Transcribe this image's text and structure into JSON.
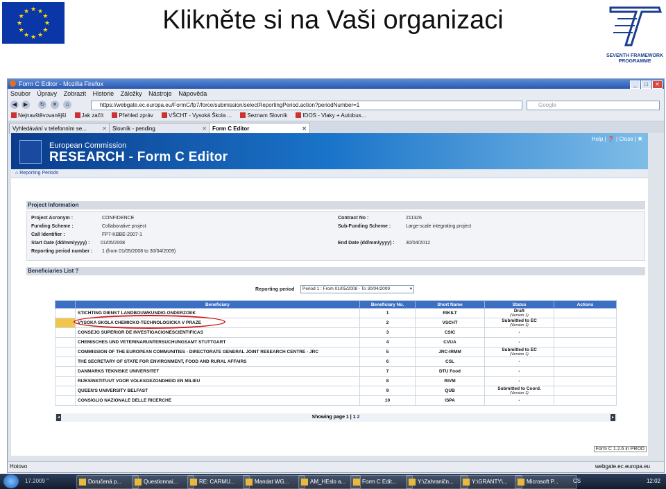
{
  "slide": {
    "title": "Klikněte si na Vaši organizaci",
    "logo_left": "eu-flag",
    "logo_right": {
      "line1": "SEVENTH FRAMEWORK",
      "line2": "PROGRAMME"
    }
  },
  "browser": {
    "window_title": "Form C Editor - Mozilla Firefox",
    "menu": [
      "Soubor",
      "Úpravy",
      "Zobrazit",
      "Historie",
      "Záložky",
      "Nástroje",
      "Nápověda"
    ],
    "url": "https://webgate.ec.europa.eu/FormC/fp7/force/submission/selectReportingPeriod.action?periodNumber=1",
    "search_placeholder": "Google",
    "bookmarks": [
      "Nejnavštěvovanější",
      "Jak začít",
      "Přehled zpráv",
      "VŠCHT - Vysoká Škola ...",
      "Seznam Slovník",
      "IDOS - Vlaky + Autobus..."
    ],
    "tabs": [
      {
        "label": "Vyhledávání v telefonním se...",
        "active": false
      },
      {
        "label": "Slovník - pending",
        "active": false
      },
      {
        "label": "Form C Editor",
        "active": true
      }
    ],
    "status_left": "Hotovo",
    "status_right": "webgate.ec.europa.eu"
  },
  "app": {
    "line1": "European Commission",
    "line2": "RESEARCH - Form C Editor",
    "help_links": "Help | ❓ | Close | ✖",
    "breadcrumb": "Reporting Periods",
    "project_section": "Project Information",
    "project": {
      "acronym_label": "Project Acronym :",
      "acronym": "CONFIDENCE",
      "funding_label": "Funding Scheme :",
      "funding": "Collaborative project",
      "call_label": "Call Identifier :",
      "call": "FP7-KBBE-2007-1",
      "start_label": "Start Date (dd/mm/yyyy) :",
      "start": "01/05/2008",
      "period_label": "Reporting period number :",
      "period": "1 (from 01/05/2008 to 30/04/2009)",
      "contract_label": "Contract No :",
      "contract": "211326",
      "subfunding_label": "Sub-Funding Scheme :",
      "subfunding": "Large-scale integrating project",
      "end_label": "End Date (dd/mm/yyyy) :",
      "end": "30/04/2012"
    },
    "beneficiaries_section": "Beneficiaries List ?",
    "reporting_period_label": "Reporting period",
    "reporting_period_value": "Period 1 : From 01/05/2008 - To 30/04/2009",
    "columns": [
      "Beneficiary",
      "Beneficiary No.",
      "Short Name",
      "Status",
      "Actions"
    ],
    "rows": [
      {
        "name": "STICHTING DIENST LANDBOUWKUNDIG ONDERZOEK",
        "no": "1",
        "short": "RIKILT",
        "status": "Draft",
        "version": "(Version 1)"
      },
      {
        "name": "VYSOKA SKOLA CHEMICKO-TECHNOLOGICKA V PRAZE",
        "no": "2",
        "short": "VSCHT",
        "status": "Submitted to EC",
        "version": "(Version 1)"
      },
      {
        "name": "CONSEJO SUPERIOR DE INVESTIGACIONESCIENTIFICAS",
        "no": "3",
        "short": "CSIC",
        "status": "-",
        "version": ""
      },
      {
        "name": "CHEMISCHES UND VETERINARUNTERSUCHUNGSAMT STUTTGART",
        "no": "4",
        "short": "CVUA",
        "status": "-",
        "version": ""
      },
      {
        "name": "COMMISSION OF THE EUROPEAN COMMUNITIES - DIRECTORATE GENERAL JOINT RESEARCH CENTRE - JRC",
        "no": "5",
        "short": "JRC-IRMM",
        "status": "Submitted to EC",
        "version": "(Version 1)"
      },
      {
        "name": "THE SECRETARY OF STATE FOR ENVIRONMENT, FOOD AND RURAL AFFAIRS",
        "no": "6",
        "short": "CSL",
        "status": "-",
        "version": ""
      },
      {
        "name": "DANMARKS TEKNISKE UNIVERSITET",
        "no": "7",
        "short": "DTU Food",
        "status": "-",
        "version": ""
      },
      {
        "name": "RIJKSINSTITUUT VOOR VOLKSGEZONDHEID EN MILIEU",
        "no": "8",
        "short": "RIVM",
        "status": "-",
        "version": ""
      },
      {
        "name": "QUEEN'S UNIVERSITY BELFAST",
        "no": "9",
        "short": "QUB",
        "status": "Submitted to Coord.",
        "version": "(Version 1)"
      },
      {
        "name": "CONSIGLIO NAZIONALE DELLE RICERCHE",
        "no": "10",
        "short": "ISPA",
        "status": "-",
        "version": ""
      }
    ],
    "pager_text": "Showing page 1 |",
    "pager_page1": "1",
    "pager_page2": "2",
    "version": "Form C 1.2.6 in PROD"
  },
  "taskbar": {
    "items": [
      "Doručená p...",
      "Questionnai...",
      "RE: CARMU...",
      "Mandat WG...",
      "AM_HEslo a...",
      "Form C Edit...",
      "Y:\\Zahraničn...",
      "Y:\\GRANTY\\...",
      "Microsoft P..."
    ],
    "language": "CS",
    "clock": "12:02",
    "date_fragment": "17.2009 ”"
  }
}
